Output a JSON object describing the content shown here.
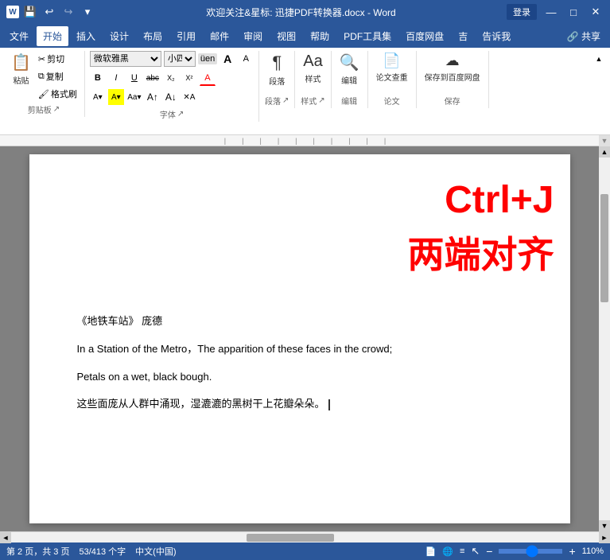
{
  "titlebar": {
    "title": "欢迎关注&星标: 迅捷PDF转换器.docx - Word",
    "login_label": "登录",
    "minimize": "—",
    "restore": "□",
    "close": "✕"
  },
  "menubar": {
    "items": [
      "文件",
      "开始",
      "插入",
      "设计",
      "布局",
      "引用",
      "邮件",
      "审阅",
      "视图",
      "帮助",
      "PDF工具集",
      "百度网盘",
      "吉",
      "告诉我",
      "共享"
    ],
    "active": "开始"
  },
  "ribbon": {
    "groups": [
      {
        "name": "clipboard",
        "label": "剪贴板",
        "buttons": [
          "粘贴",
          "剪切",
          "复制",
          "格式刷"
        ]
      },
      {
        "name": "font",
        "label": "字体",
        "font_name": "微软雅黑",
        "font_size": "小四"
      },
      {
        "name": "paragraph",
        "label": "段落"
      },
      {
        "name": "styles",
        "label": "样式"
      },
      {
        "name": "editing",
        "label": "编辑"
      },
      {
        "name": "paper",
        "label": "论文查重"
      },
      {
        "name": "baidu",
        "label": "保存到百度网盘"
      }
    ]
  },
  "document": {
    "overlay_shortcut": "Ctrl+J",
    "overlay_label": "两端对齐",
    "lines": [
      {
        "id": "poem-title",
        "text": "《地铁车站》 庞德"
      },
      {
        "id": "eng-line1",
        "text": "In a Station of the Metro，The apparition of these faces in the crowd;"
      },
      {
        "id": "eng-line2",
        "text": "Petals on a wet, black bough."
      },
      {
        "id": "chin-line",
        "text": "这些面庞从人群中涌现，湿漉漉的黑树干上花瓣朵朵。"
      }
    ]
  },
  "statusbar": {
    "page_info": "第 2 页，共 3 页",
    "word_count": "53/413 个字",
    "language": "中文(中国)",
    "zoom_level": "110%"
  },
  "icons": {
    "save": "💾",
    "undo": "↩",
    "redo": "↪",
    "down_arrow": "▾",
    "left_arrow": "◄",
    "right_arrow": "►",
    "up_arrow": "▲",
    "down_arrow2": "▼",
    "bold": "B",
    "italic": "I",
    "underline": "U",
    "strikethrough": "abc",
    "superscript": "x²",
    "subscript": "x₂",
    "font_color": "A",
    "grow": "A↑",
    "shrink": "A↓",
    "change_case": "Aa",
    "clear": "✕"
  }
}
